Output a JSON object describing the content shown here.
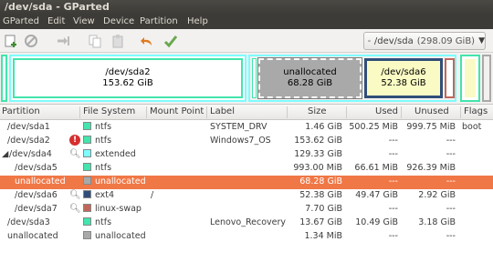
{
  "window": {
    "title": "/dev/sda - GParted"
  },
  "menu": [
    "GParted",
    "Edit",
    "View",
    "Device",
    "Partition",
    "Help"
  ],
  "toolbar": {
    "icons": [
      "new-partition-icon",
      "delete-icon",
      "resize-move-icon",
      "copy-icon",
      "paste-icon",
      "undo-icon",
      "apply-icon"
    ]
  },
  "device": {
    "name": "/dev/sda",
    "size": "(298.09 GiB)"
  },
  "map": {
    "sda2": {
      "name": "/dev/sda2",
      "size": "153.62 GiB"
    },
    "unalloc": {
      "name": "unallocated",
      "size": "68.28 GiB"
    },
    "sda6": {
      "name": "/dev/sda6",
      "size": "52.38 GiB"
    }
  },
  "columns": [
    "Partition",
    "File System",
    "Mount Point",
    "Label",
    "Size",
    "Used",
    "Unused",
    "Flags"
  ],
  "colors": {
    "ntfs": "#42e5ac",
    "extended": "#7dfcfe",
    "unallocated": "#a9a9a9",
    "ext4": "#314e7a",
    "linux-swap": "#c1665a",
    "selected": "#f07746"
  },
  "rows": [
    {
      "partition": "/dev/sda1",
      "fs": "ntfs",
      "mount": "",
      "label": "SYSTEM_DRV",
      "size": "1.46 GiB",
      "used": "500.25 MiB",
      "unused": "999.75 MiB",
      "flags": "boot",
      "icon": ""
    },
    {
      "partition": "/dev/sda2",
      "fs": "ntfs",
      "mount": "",
      "label": "Windows7_OS",
      "size": "153.62 GiB",
      "used": "---",
      "unused": "---",
      "flags": "",
      "icon": "error"
    },
    {
      "partition": "/dev/sda4",
      "fs": "extended",
      "mount": "",
      "label": "",
      "size": "129.33 GiB",
      "used": "---",
      "unused": "---",
      "flags": "",
      "icon": "search"
    },
    {
      "partition": "/dev/sda5",
      "fs": "ntfs",
      "mount": "",
      "label": "",
      "size": "993.00 MiB",
      "used": "66.61 MiB",
      "unused": "926.39 MiB",
      "flags": "",
      "icon": ""
    },
    {
      "partition": "unallocated",
      "fs": "unallocated",
      "mount": "",
      "label": "",
      "size": "68.28 GiB",
      "used": "---",
      "unused": "---",
      "flags": "",
      "icon": "",
      "selected": true
    },
    {
      "partition": "/dev/sda6",
      "fs": "ext4",
      "mount": "/",
      "label": "",
      "size": "52.38 GiB",
      "used": "49.47 GiB",
      "unused": "2.92 GiB",
      "flags": "",
      "icon": "search"
    },
    {
      "partition": "/dev/sda7",
      "fs": "linux-swap",
      "mount": "",
      "label": "",
      "size": "7.70 GiB",
      "used": "---",
      "unused": "---",
      "flags": "",
      "icon": "search"
    },
    {
      "partition": "/dev/sda3",
      "fs": "ntfs",
      "mount": "",
      "label": "Lenovo_Recovery",
      "size": "13.67 GiB",
      "used": "10.49 GiB",
      "unused": "3.18 GiB",
      "flags": "",
      "icon": ""
    },
    {
      "partition": "unallocated",
      "fs": "unallocated",
      "mount": "",
      "label": "",
      "size": "1.34 MiB",
      "used": "---",
      "unused": "---",
      "flags": "",
      "icon": ""
    }
  ]
}
